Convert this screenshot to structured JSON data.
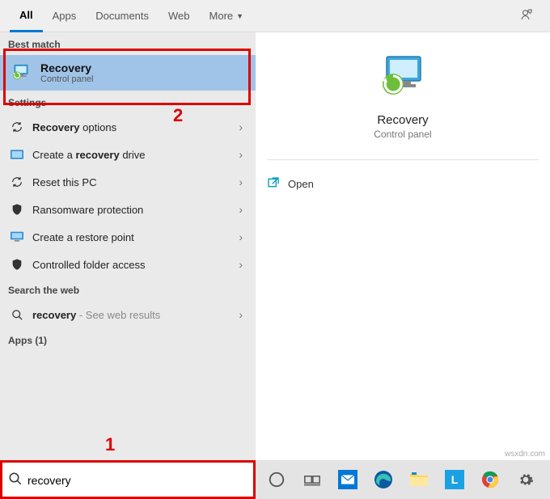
{
  "tabs": {
    "all": "All",
    "apps": "Apps",
    "documents": "Documents",
    "web": "Web",
    "more": "More"
  },
  "sections": {
    "bestMatch": "Best match",
    "settings": "Settings",
    "searchWeb": "Search the web",
    "apps": "Apps (1)"
  },
  "bestMatch": {
    "title": "Recovery",
    "subtitle": "Control panel"
  },
  "settingsList": [
    {
      "label_pre": "",
      "label_bold": "Recovery",
      "label_post": " options"
    },
    {
      "label_pre": "Create a ",
      "label_bold": "recovery",
      "label_post": " drive"
    },
    {
      "label_pre": "Reset this PC",
      "label_bold": "",
      "label_post": ""
    },
    {
      "label_pre": "Ransomware protection",
      "label_bold": "",
      "label_post": ""
    },
    {
      "label_pre": "Create a restore point",
      "label_bold": "",
      "label_post": ""
    },
    {
      "label_pre": "Controlled folder access",
      "label_bold": "",
      "label_post": ""
    }
  ],
  "webRow": {
    "term": "recovery",
    "suffix": " - See web results"
  },
  "rightPane": {
    "title": "Recovery",
    "subtitle": "Control panel",
    "open": "Open"
  },
  "search": {
    "value": "recovery"
  },
  "annotations": {
    "a1": "1",
    "a2": "2"
  },
  "watermark": "wsxdn.com"
}
